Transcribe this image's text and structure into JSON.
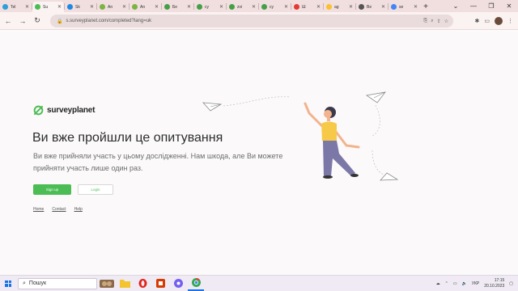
{
  "browser": {
    "tabs": [
      {
        "title": "Tel",
        "color": "#2aa1da"
      },
      {
        "title": "Su",
        "color": "#4cbd54",
        "active": true
      },
      {
        "title": "Sk",
        "color": "#1e88e5"
      },
      {
        "title": "An",
        "color": "#7cb342"
      },
      {
        "title": "An",
        "color": "#7cb342"
      },
      {
        "title": "Бе",
        "color": "#43a047"
      },
      {
        "title": "су",
        "color": "#43a047"
      },
      {
        "title": "zvi",
        "color": "#43a047"
      },
      {
        "title": "су",
        "color": "#43a047"
      },
      {
        "title": "Ш",
        "color": "#e53935"
      },
      {
        "title": "ag",
        "color": "#fbc02d"
      },
      {
        "title": "Ве",
        "color": "#555555"
      },
      {
        "title": "se",
        "color": "#4285f4"
      }
    ],
    "new_tab": "+",
    "window_controls": {
      "minimize": "⌄",
      "maximize": "—",
      "restore": "❐",
      "close": "✕"
    },
    "nav": {
      "back": "←",
      "forward": "→",
      "reload": "↻",
      "home": "⌂"
    },
    "url": "s.surveyplanet.com/completed?lang=uk"
  },
  "page": {
    "logo_text": "surveyplanet",
    "heading": "Ви вже пройшли це опитування",
    "description": "Ви вже прийняли участь у цьому дослідженні. Нам шкода, але Ви можете прийняти участь лише один раз.",
    "signup_label": "Sign up",
    "login_label": "Login",
    "footer_links": [
      "Home",
      "Contact",
      "Help"
    ]
  },
  "taskbar": {
    "search_placeholder": "Пошук",
    "language": "УКР",
    "time": "17:15",
    "date": "20.10.2023"
  }
}
